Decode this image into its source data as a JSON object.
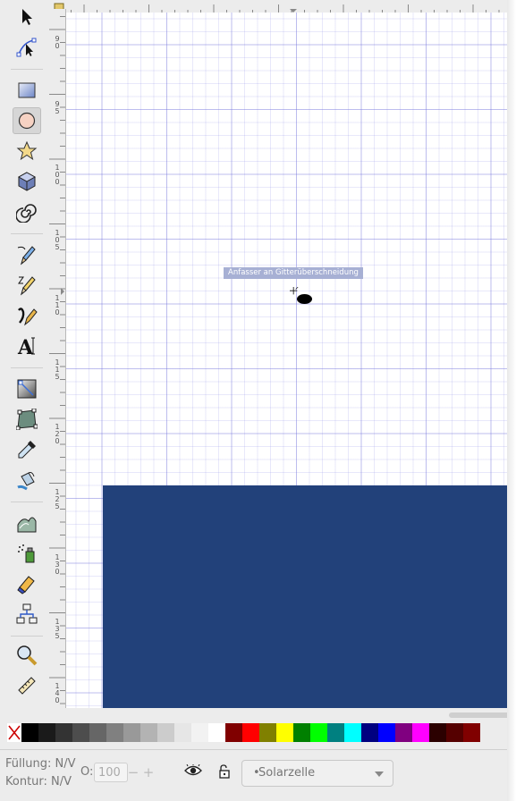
{
  "canvas": {
    "tooltip": "Anfasser an Gitterüberschneidung",
    "object_color": "#22417a",
    "grid_color": "#7676dc"
  },
  "tools": [
    {
      "name": "selector-tool",
      "icon": "arrow-icon"
    },
    {
      "name": "node-tool",
      "icon": "node-edit-icon"
    },
    {
      "name": "rectangle-tool",
      "icon": "rectangle-icon"
    },
    {
      "name": "ellipse-tool",
      "icon": "ellipse-icon",
      "active": true
    },
    {
      "name": "star-tool",
      "icon": "star-icon"
    },
    {
      "name": "3d-box-tool",
      "icon": "box-3d-icon"
    },
    {
      "name": "spiral-tool",
      "icon": "spiral-icon"
    },
    {
      "name": "pencil-tool",
      "icon": "pencil-icon"
    },
    {
      "name": "pen-tool",
      "icon": "pen-icon"
    },
    {
      "name": "calligraphy-tool",
      "icon": "calligraphy-icon"
    },
    {
      "name": "text-tool",
      "icon": "text-icon"
    },
    {
      "name": "gradient-tool",
      "icon": "gradient-icon"
    },
    {
      "name": "mesh-tool",
      "icon": "mesh-icon"
    },
    {
      "name": "dropper-tool",
      "icon": "dropper-icon"
    },
    {
      "name": "paint-bucket-tool",
      "icon": "paint-bucket-icon"
    },
    {
      "name": "tweak-tool",
      "icon": "tweak-icon"
    },
    {
      "name": "spray-tool",
      "icon": "spray-icon"
    },
    {
      "name": "eraser-tool",
      "icon": "eraser-icon"
    },
    {
      "name": "connector-tool",
      "icon": "connector-icon"
    },
    {
      "name": "zoom-tool",
      "icon": "zoom-icon"
    },
    {
      "name": "measure-tool",
      "icon": "measure-icon"
    }
  ],
  "vruler_labels": [
    "9\n0",
    "9\n5",
    "1\n0\n0",
    "1\n0\n5",
    "1\n1\n0",
    "1\n1\n5",
    "1\n2\n0",
    "1\n2\n5",
    "1\n3\n0",
    "1\n3\n5",
    "1\n4\n0"
  ],
  "palette": [
    "#000000",
    "#1a1a1a",
    "#333333",
    "#4d4d4d",
    "#666666",
    "#808080",
    "#999999",
    "#b3b3b3",
    "#cccccc",
    "#e6e6e6",
    "#f2f2f2",
    "#ffffff",
    "#800000",
    "#ff0000",
    "#808000",
    "#ffff00",
    "#008000",
    "#00ff00",
    "#008080",
    "#00ffff",
    "#000080",
    "#0000ff",
    "#800080",
    "#ff00ff",
    "#2b0000",
    "#550000",
    "#800000"
  ],
  "statusbar": {
    "fill_label": "Füllung:",
    "fill_value": "N/V",
    "stroke_label": "Kontur:",
    "stroke_value": "N/V",
    "opacity_label": "O:",
    "opacity_value": "100",
    "minus": "−",
    "plus": "+",
    "layer_bullet": "•",
    "layer_name": "Solarzelle"
  }
}
